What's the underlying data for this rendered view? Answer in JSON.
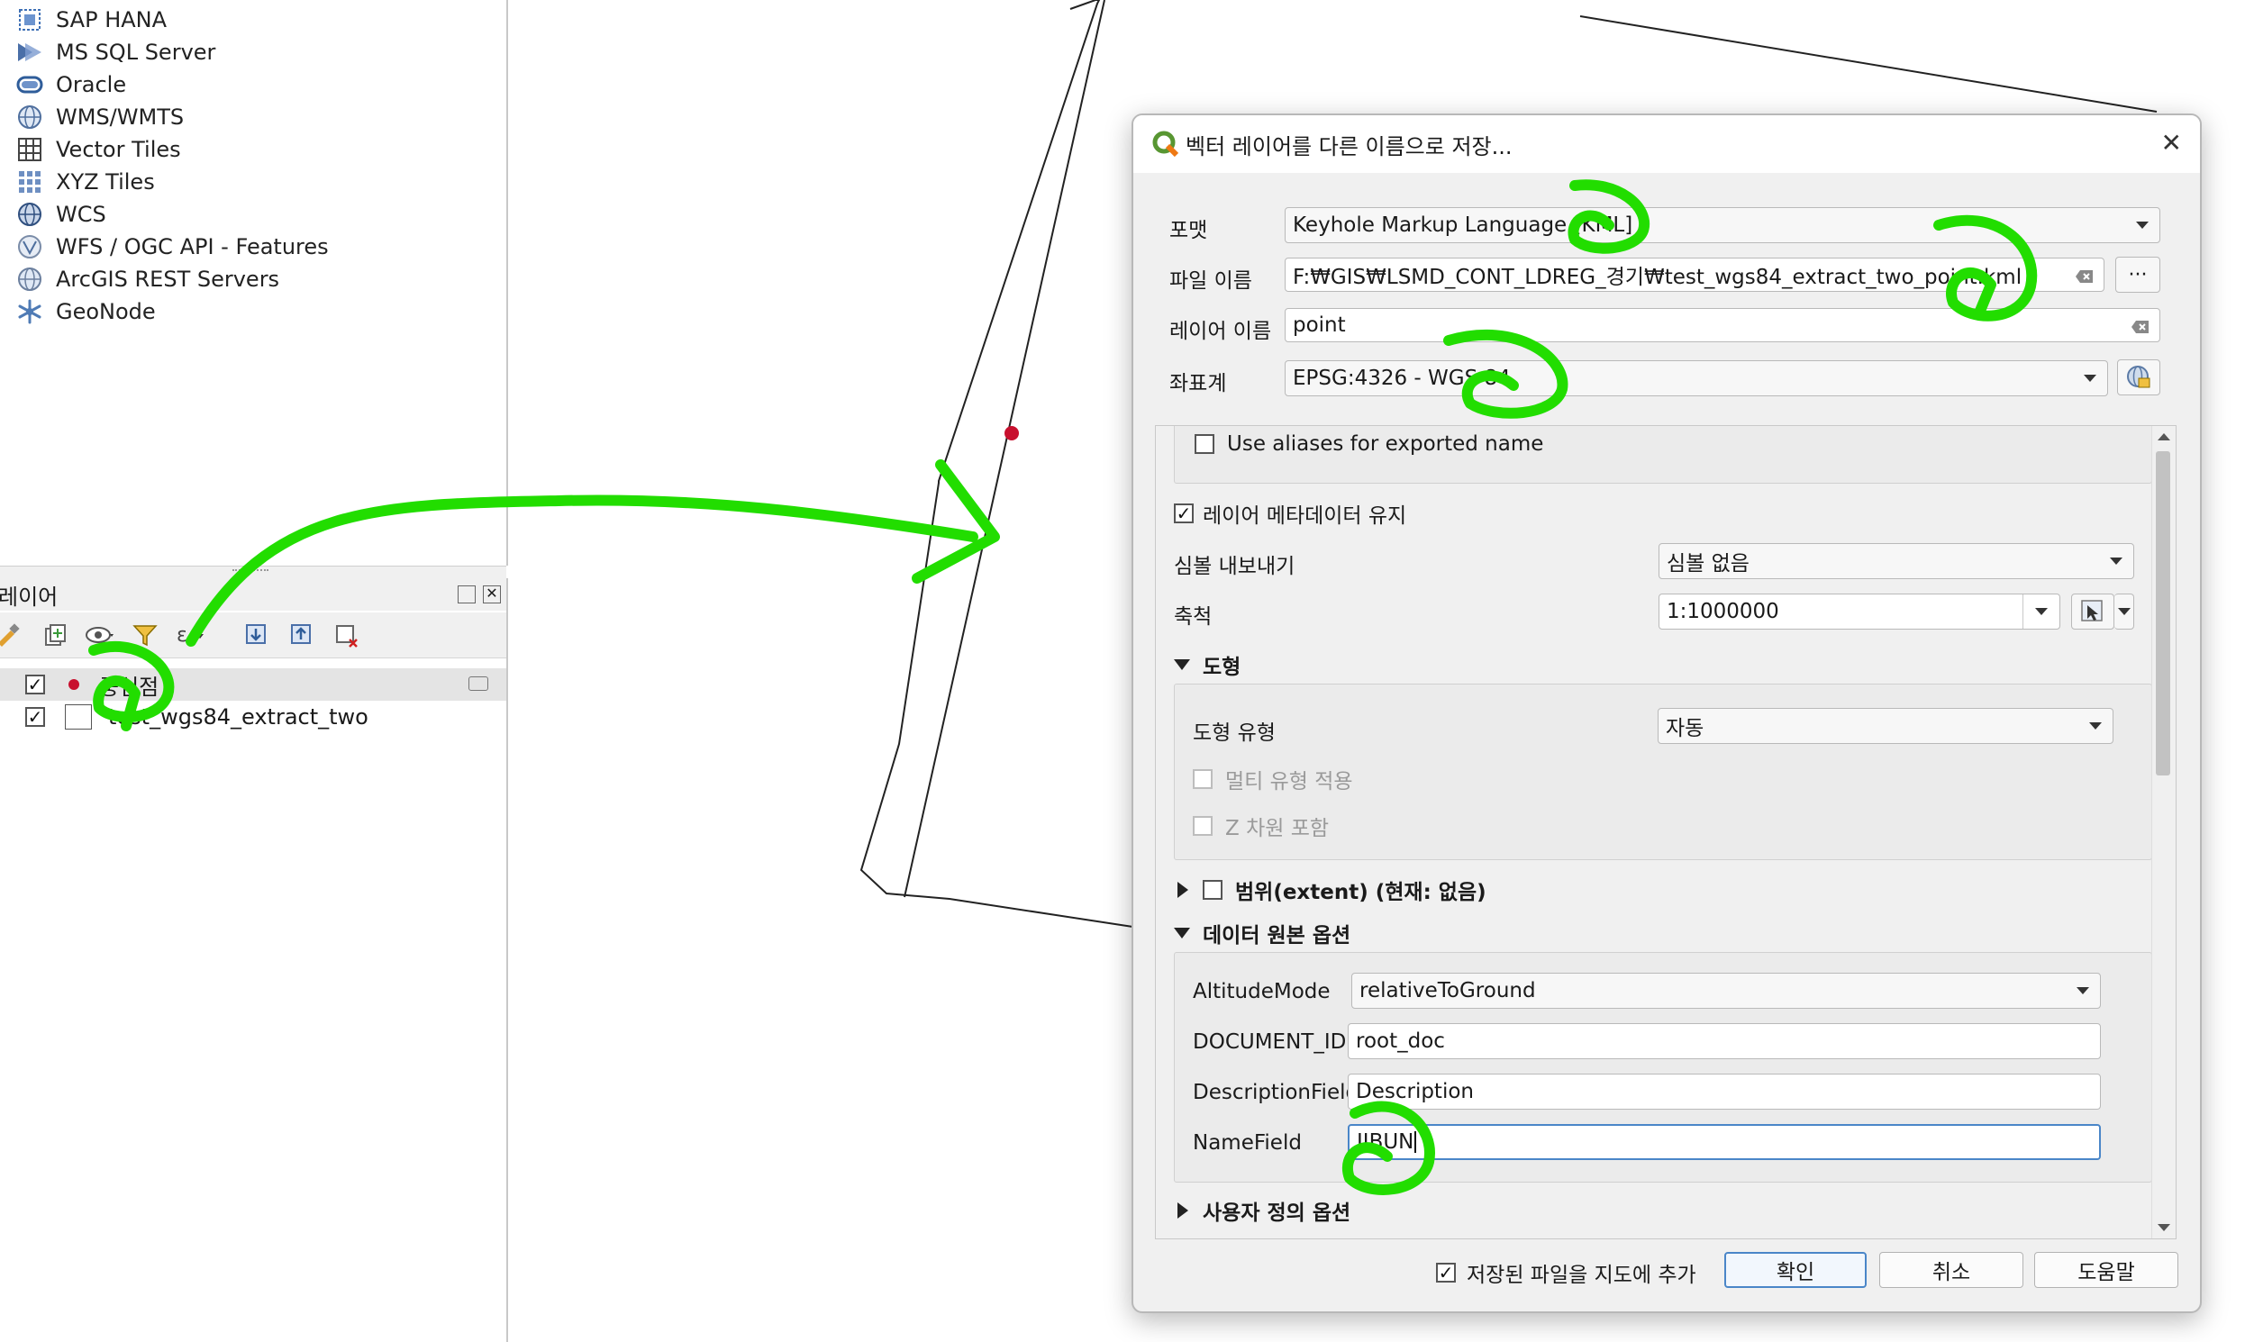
{
  "browser": {
    "items": [
      {
        "label": "SAP HANA",
        "icon": "sap-hana-icon"
      },
      {
        "label": "MS SQL Server",
        "icon": "mssql-icon"
      },
      {
        "label": "Oracle",
        "icon": "oracle-icon"
      },
      {
        "label": "WMS/WMTS",
        "icon": "wms-globe-icon"
      },
      {
        "label": "Vector Tiles",
        "icon": "vector-tiles-icon"
      },
      {
        "label": "XYZ Tiles",
        "icon": "xyz-tiles-icon"
      },
      {
        "label": "WCS",
        "icon": "wcs-globe-icon"
      },
      {
        "label": "WFS / OGC API - Features",
        "icon": "wfs-globe-icon"
      },
      {
        "label": "ArcGIS REST Servers",
        "icon": "arcgis-globe-icon"
      },
      {
        "label": "GeoNode",
        "icon": "geonode-icon"
      }
    ]
  },
  "layers_panel": {
    "title": "레이어",
    "layers": [
      {
        "name": "중심점",
        "checked": true,
        "symbol_color": "#c8102e"
      },
      {
        "name": "test_wgs84_extract_two",
        "checked": true
      }
    ]
  },
  "dialog": {
    "title": "벡터 레이어를 다른 이름으로 저장...",
    "close_glyph": "✕",
    "format_label": "포맷",
    "format_value": "Keyhole Markup Language [KML]",
    "filename_label": "파일 이름",
    "filename_value": "F:₩GIS₩LSMD_CONT_LDREG_경기₩test_wgs84_extract_two_point.kml",
    "browse_label": "···",
    "layername_label": "레이어 이름",
    "layername_value": "point",
    "crs_label": "좌표계",
    "crs_value": "EPSG:4326 - WGS 84",
    "use_aliases_label": "Use aliases for exported name",
    "keep_metadata_label": "레이어 메타데이터 유지",
    "symbology_label": "심볼 내보내기",
    "symbology_value": "심볼 없음",
    "scale_label": "축척",
    "scale_value": "1:1000000",
    "geometry_section": "도형",
    "geometry_type_label": "도형 유형",
    "geometry_type_value": "자동",
    "multi_type_label": "멀티 유형 적용",
    "z_dimension_label": "Z 차원 포함",
    "extent_section": "범위(extent) (현재: 없음)",
    "datasource_section": "데이터 원본 옵션",
    "altitude_label": "AltitudeMode",
    "altitude_value": "relativeToGround",
    "document_id_label": "DOCUMENT_ID",
    "document_id_value": "root_doc",
    "description_field_label": "DescriptionField",
    "description_field_value": "Description",
    "name_field_label": "NameField",
    "name_field_value": "JIBUN",
    "custom_options_section": "사용자 정의 옵션",
    "add_to_map_label": "저장된 파일을 지도에 추가",
    "ok_label": "확인",
    "cancel_label": "취소",
    "help_label": "도움말"
  },
  "annotation_color": "#22dd00",
  "map_point_color": "#c8102e"
}
